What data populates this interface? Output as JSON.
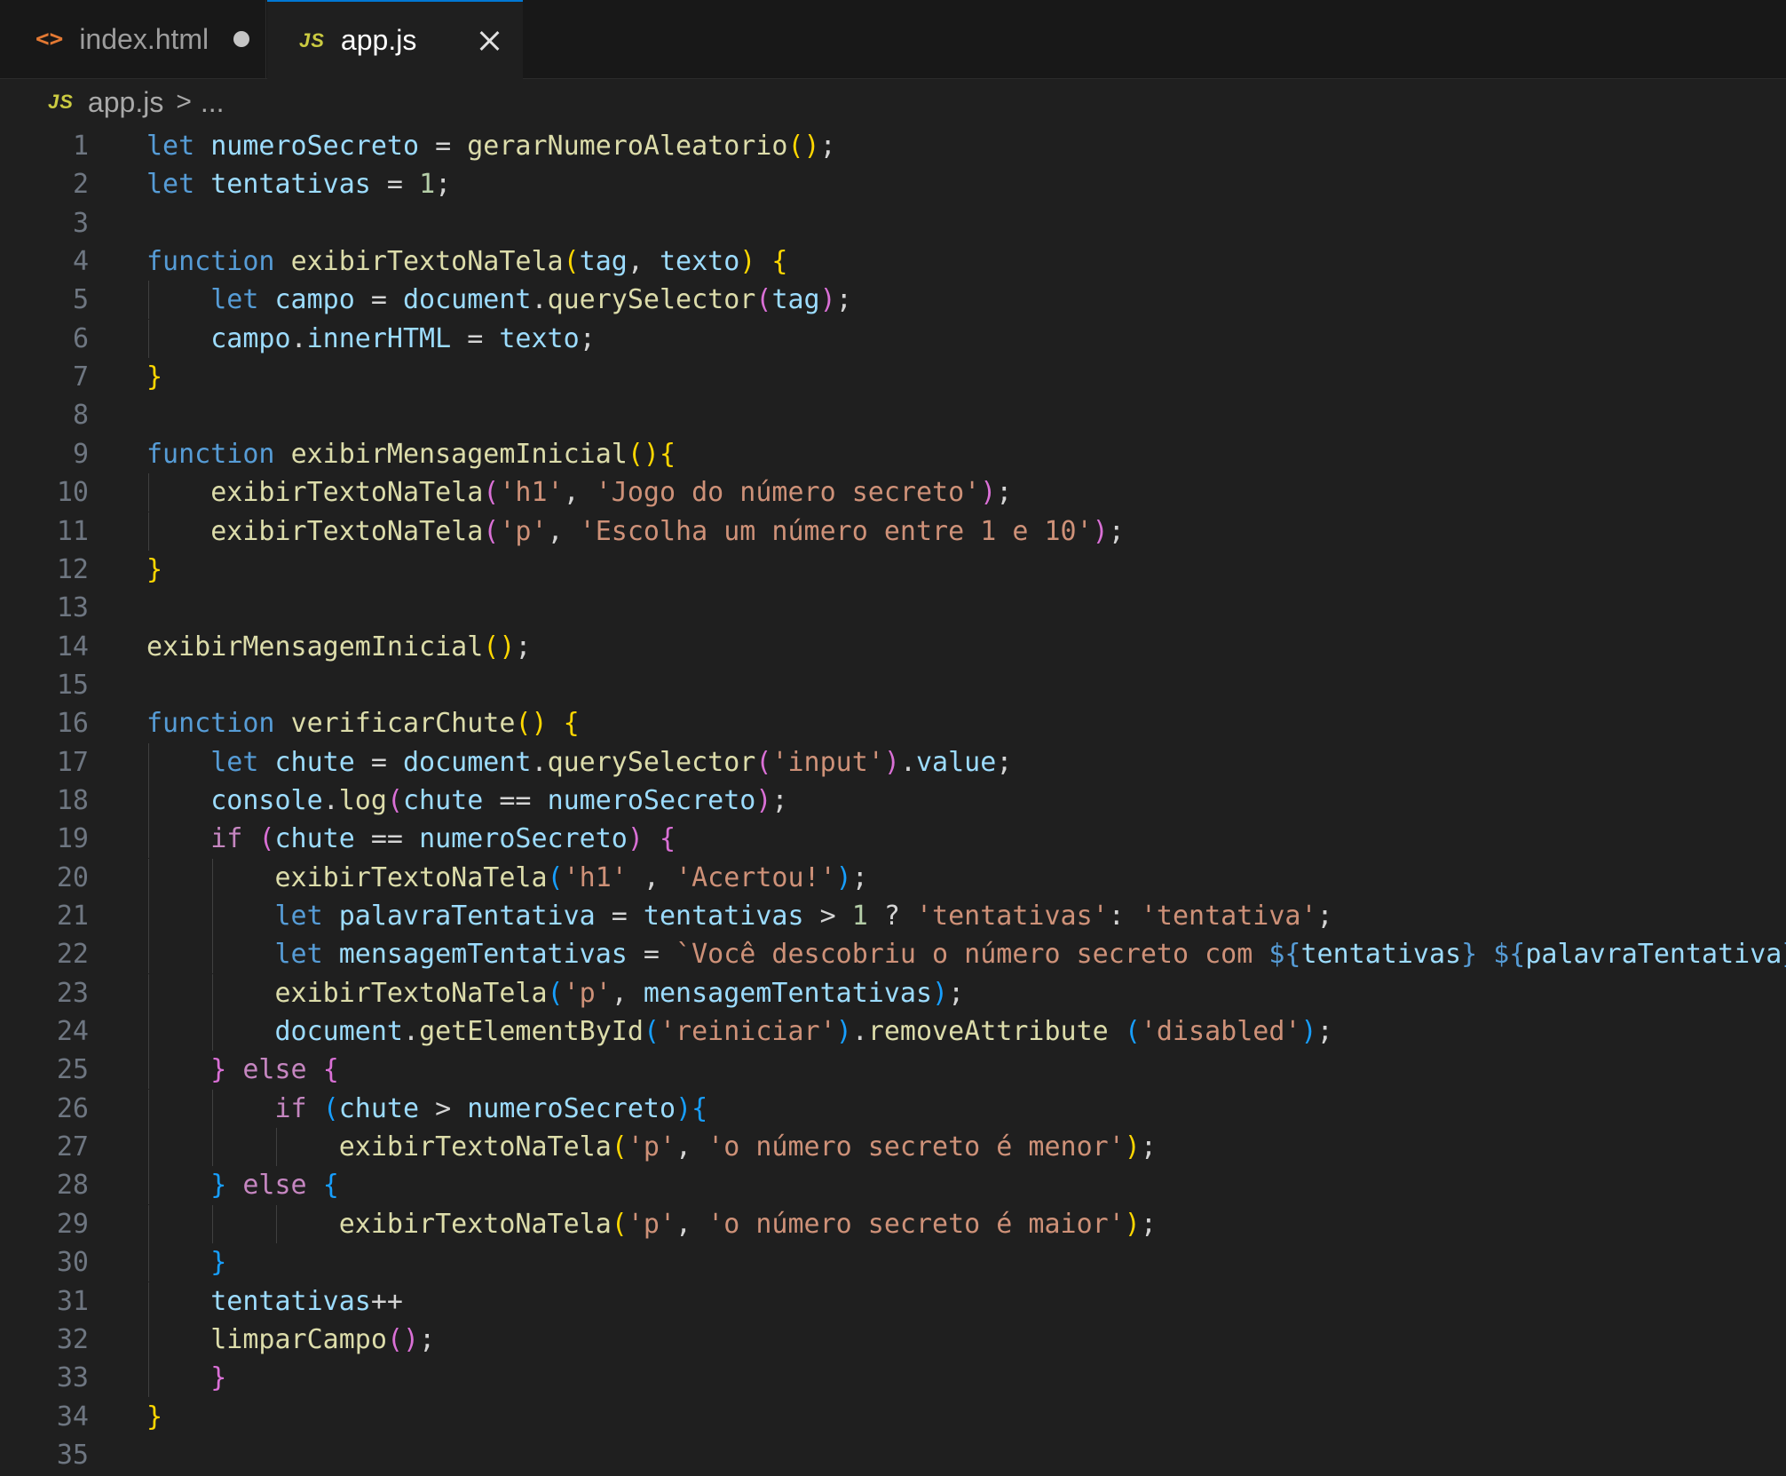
{
  "tabs": [
    {
      "icon": "html-icon",
      "glyph": "<>",
      "label": "index.html",
      "modified": true,
      "active": false
    },
    {
      "icon": "js-icon",
      "glyph": "JS",
      "label": "app.js",
      "modified": false,
      "active": true
    }
  ],
  "breadcrumb": {
    "icon_glyph": "JS",
    "file": "app.js",
    "separator": ">",
    "more": "..."
  },
  "editor": {
    "lines": [
      {
        "n": "1",
        "guides": [],
        "tokens": [
          [
            "k",
            "let"
          ],
          [
            "p",
            " "
          ],
          [
            "v",
            "numeroSecreto"
          ],
          [
            "p",
            " = "
          ],
          [
            "f",
            "gerarNumeroAleatorio"
          ],
          [
            "b1",
            "()"
          ],
          [
            "p",
            ";"
          ]
        ]
      },
      {
        "n": "2",
        "guides": [],
        "tokens": [
          [
            "k",
            "let"
          ],
          [
            "p",
            " "
          ],
          [
            "v",
            "tentativas"
          ],
          [
            "p",
            " = "
          ],
          [
            "n",
            "1"
          ],
          [
            "p",
            ";"
          ]
        ]
      },
      {
        "n": "3",
        "guides": [],
        "tokens": []
      },
      {
        "n": "4",
        "guides": [],
        "tokens": [
          [
            "k",
            "function"
          ],
          [
            "p",
            " "
          ],
          [
            "f",
            "exibirTextoNaTela"
          ],
          [
            "b1",
            "("
          ],
          [
            "v",
            "tag"
          ],
          [
            "p",
            ", "
          ],
          [
            "v",
            "texto"
          ],
          [
            "b1",
            ")"
          ],
          [
            "p",
            " "
          ],
          [
            "b1",
            "{"
          ]
        ]
      },
      {
        "n": "5",
        "guides": [
          1
        ],
        "tokens": [
          [
            "p",
            "    "
          ],
          [
            "k",
            "let"
          ],
          [
            "p",
            " "
          ],
          [
            "v",
            "campo"
          ],
          [
            "p",
            " = "
          ],
          [
            "v",
            "document"
          ],
          [
            "p",
            "."
          ],
          [
            "f",
            "querySelector"
          ],
          [
            "b2",
            "("
          ],
          [
            "v",
            "tag"
          ],
          [
            "b2",
            ")"
          ],
          [
            "p",
            ";"
          ]
        ]
      },
      {
        "n": "6",
        "guides": [
          1
        ],
        "tokens": [
          [
            "p",
            "    "
          ],
          [
            "v",
            "campo"
          ],
          [
            "p",
            "."
          ],
          [
            "v",
            "innerHTML"
          ],
          [
            "p",
            " = "
          ],
          [
            "v",
            "texto"
          ],
          [
            "p",
            ";"
          ]
        ]
      },
      {
        "n": "7",
        "guides": [],
        "tokens": [
          [
            "b1",
            "}"
          ]
        ]
      },
      {
        "n": "8",
        "guides": [],
        "tokens": []
      },
      {
        "n": "9",
        "guides": [],
        "tokens": [
          [
            "k",
            "function"
          ],
          [
            "p",
            " "
          ],
          [
            "f",
            "exibirMensagemInicial"
          ],
          [
            "b1",
            "(){"
          ]
        ]
      },
      {
        "n": "10",
        "guides": [
          1
        ],
        "tokens": [
          [
            "p",
            "    "
          ],
          [
            "f",
            "exibirTextoNaTela"
          ],
          [
            "b2",
            "("
          ],
          [
            "s",
            "'h1'"
          ],
          [
            "p",
            ", "
          ],
          [
            "s",
            "'Jogo do número secreto'"
          ],
          [
            "b2",
            ")"
          ],
          [
            "p",
            ";"
          ]
        ]
      },
      {
        "n": "11",
        "guides": [
          1
        ],
        "tokens": [
          [
            "p",
            "    "
          ],
          [
            "f",
            "exibirTextoNaTela"
          ],
          [
            "b2",
            "("
          ],
          [
            "s",
            "'p'"
          ],
          [
            "p",
            ", "
          ],
          [
            "s",
            "'Escolha um número entre 1 e 10'"
          ],
          [
            "b2",
            ")"
          ],
          [
            "p",
            ";"
          ]
        ]
      },
      {
        "n": "12",
        "guides": [],
        "tokens": [
          [
            "b1",
            "}"
          ]
        ]
      },
      {
        "n": "13",
        "guides": [],
        "tokens": []
      },
      {
        "n": "14",
        "guides": [],
        "tokens": [
          [
            "f",
            "exibirMensagemInicial"
          ],
          [
            "b1",
            "()"
          ],
          [
            "p",
            ";"
          ]
        ]
      },
      {
        "n": "15",
        "guides": [],
        "tokens": []
      },
      {
        "n": "16",
        "guides": [],
        "tokens": [
          [
            "k",
            "function"
          ],
          [
            "p",
            " "
          ],
          [
            "f",
            "verificarChute"
          ],
          [
            "b1",
            "()"
          ],
          [
            "p",
            " "
          ],
          [
            "b1",
            "{"
          ]
        ]
      },
      {
        "n": "17",
        "guides": [
          1
        ],
        "tokens": [
          [
            "p",
            "    "
          ],
          [
            "k",
            "let"
          ],
          [
            "p",
            " "
          ],
          [
            "v",
            "chute"
          ],
          [
            "p",
            " = "
          ],
          [
            "v",
            "document"
          ],
          [
            "p",
            "."
          ],
          [
            "f",
            "querySelector"
          ],
          [
            "b2",
            "("
          ],
          [
            "s",
            "'input'"
          ],
          [
            "b2",
            ")"
          ],
          [
            "p",
            "."
          ],
          [
            "v",
            "value"
          ],
          [
            "p",
            ";"
          ]
        ]
      },
      {
        "n": "18",
        "guides": [
          1
        ],
        "tokens": [
          [
            "p",
            "    "
          ],
          [
            "v",
            "console"
          ],
          [
            "p",
            "."
          ],
          [
            "f",
            "log"
          ],
          [
            "b2",
            "("
          ],
          [
            "v",
            "chute"
          ],
          [
            "p",
            " == "
          ],
          [
            "v",
            "numeroSecreto"
          ],
          [
            "b2",
            ")"
          ],
          [
            "p",
            ";"
          ]
        ]
      },
      {
        "n": "19",
        "guides": [
          1
        ],
        "tokens": [
          [
            "p",
            "    "
          ],
          [
            "c",
            "if"
          ],
          [
            "p",
            " "
          ],
          [
            "b2",
            "("
          ],
          [
            "v",
            "chute"
          ],
          [
            "p",
            " == "
          ],
          [
            "v",
            "numeroSecreto"
          ],
          [
            "b2",
            ")"
          ],
          [
            "p",
            " "
          ],
          [
            "b2",
            "{"
          ]
        ]
      },
      {
        "n": "20",
        "guides": [
          1,
          2
        ],
        "tokens": [
          [
            "p",
            "        "
          ],
          [
            "f",
            "exibirTextoNaTela"
          ],
          [
            "b3",
            "("
          ],
          [
            "s",
            "'h1'"
          ],
          [
            "p",
            " , "
          ],
          [
            "s",
            "'Acertou!'"
          ],
          [
            "b3",
            ")"
          ],
          [
            "p",
            ";"
          ]
        ]
      },
      {
        "n": "21",
        "guides": [
          1,
          2
        ],
        "tokens": [
          [
            "p",
            "        "
          ],
          [
            "k",
            "let"
          ],
          [
            "p",
            " "
          ],
          [
            "v",
            "palavraTentativa"
          ],
          [
            "p",
            " = "
          ],
          [
            "v",
            "tentativas"
          ],
          [
            "p",
            " > "
          ],
          [
            "n",
            "1"
          ],
          [
            "p",
            " ? "
          ],
          [
            "s",
            "'tentativas'"
          ],
          [
            "p",
            ": "
          ],
          [
            "s",
            "'tentativa'"
          ],
          [
            "p",
            ";"
          ]
        ]
      },
      {
        "n": "22",
        "guides": [
          1,
          2
        ],
        "tokens": [
          [
            "p",
            "        "
          ],
          [
            "k",
            "let"
          ],
          [
            "p",
            " "
          ],
          [
            "v",
            "mensagemTentativas"
          ],
          [
            "p",
            " = "
          ],
          [
            "s",
            "`Você descobriu o número secreto com "
          ],
          [
            "k",
            "${"
          ],
          [
            "v",
            "tentativas"
          ],
          [
            "k",
            "}"
          ],
          [
            "p",
            " "
          ],
          [
            "k",
            "${"
          ],
          [
            "v",
            "palavraTentativa"
          ],
          [
            "k",
            "}"
          ],
          [
            "s",
            "!`"
          ],
          [
            "p",
            ";"
          ]
        ]
      },
      {
        "n": "23",
        "guides": [
          1,
          2
        ],
        "tokens": [
          [
            "p",
            "        "
          ],
          [
            "f",
            "exibirTextoNaTela"
          ],
          [
            "b3",
            "("
          ],
          [
            "s",
            "'p'"
          ],
          [
            "p",
            ", "
          ],
          [
            "v",
            "mensagemTentativas"
          ],
          [
            "b3",
            ")"
          ],
          [
            "p",
            ";"
          ]
        ]
      },
      {
        "n": "24",
        "guides": [
          1,
          2
        ],
        "tokens": [
          [
            "p",
            "        "
          ],
          [
            "v",
            "document"
          ],
          [
            "p",
            "."
          ],
          [
            "f",
            "getElementById"
          ],
          [
            "b3",
            "("
          ],
          [
            "s",
            "'reiniciar'"
          ],
          [
            "b3",
            ")"
          ],
          [
            "p",
            "."
          ],
          [
            "f",
            "removeAttribute"
          ],
          [
            "p",
            " "
          ],
          [
            "b3",
            "("
          ],
          [
            "s",
            "'disabled'"
          ],
          [
            "b3",
            ")"
          ],
          [
            "p",
            ";"
          ]
        ]
      },
      {
        "n": "25",
        "guides": [
          1
        ],
        "tokens": [
          [
            "p",
            "    "
          ],
          [
            "b2",
            "}"
          ],
          [
            "p",
            " "
          ],
          [
            "c",
            "else"
          ],
          [
            "p",
            " "
          ],
          [
            "b2",
            "{"
          ]
        ]
      },
      {
        "n": "26",
        "guides": [
          1,
          2
        ],
        "tokens": [
          [
            "p",
            "        "
          ],
          [
            "c",
            "if"
          ],
          [
            "p",
            " "
          ],
          [
            "b3",
            "("
          ],
          [
            "v",
            "chute"
          ],
          [
            "p",
            " > "
          ],
          [
            "v",
            "numeroSecreto"
          ],
          [
            "b3",
            ")"
          ],
          [
            "b3",
            "{"
          ]
        ]
      },
      {
        "n": "27",
        "guides": [
          1,
          2,
          3
        ],
        "tokens": [
          [
            "p",
            "            "
          ],
          [
            "f",
            "exibirTextoNaTela"
          ],
          [
            "b1",
            "("
          ],
          [
            "s",
            "'p'"
          ],
          [
            "p",
            ", "
          ],
          [
            "s",
            "'o número secreto é menor'"
          ],
          [
            "b1",
            ")"
          ],
          [
            "p",
            ";"
          ]
        ]
      },
      {
        "n": "28",
        "guides": [
          1
        ],
        "tokens": [
          [
            "p",
            "    "
          ],
          [
            "b3",
            "}"
          ],
          [
            "p",
            " "
          ],
          [
            "c",
            "else"
          ],
          [
            "p",
            " "
          ],
          [
            "b3",
            "{"
          ]
        ]
      },
      {
        "n": "29",
        "guides": [
          1,
          2,
          3
        ],
        "tokens": [
          [
            "p",
            "            "
          ],
          [
            "f",
            "exibirTextoNaTela"
          ],
          [
            "b1",
            "("
          ],
          [
            "s",
            "'p'"
          ],
          [
            "p",
            ", "
          ],
          [
            "s",
            "'o número secreto é maior'"
          ],
          [
            "b1",
            ")"
          ],
          [
            "p",
            ";"
          ]
        ]
      },
      {
        "n": "30",
        "guides": [
          1
        ],
        "tokens": [
          [
            "p",
            "    "
          ],
          [
            "b3",
            "}"
          ]
        ]
      },
      {
        "n": "31",
        "guides": [
          1
        ],
        "tokens": [
          [
            "p",
            "    "
          ],
          [
            "v",
            "tentativas"
          ],
          [
            "p",
            "++"
          ]
        ]
      },
      {
        "n": "32",
        "guides": [
          1
        ],
        "tokens": [
          [
            "p",
            "    "
          ],
          [
            "f",
            "limparCampo"
          ],
          [
            "b2",
            "("
          ],
          [
            "b2",
            ")"
          ],
          [
            "p",
            ";"
          ]
        ]
      },
      {
        "n": "33",
        "guides": [
          1
        ],
        "tokens": [
          [
            "p",
            "    "
          ],
          [
            "b2",
            "}"
          ]
        ]
      },
      {
        "n": "34",
        "guides": [],
        "tokens": [
          [
            "b1",
            "}"
          ]
        ]
      },
      {
        "n": "35",
        "guides": [],
        "tokens": []
      }
    ]
  },
  "colors": {
    "background": "#1f1f1f",
    "tabbar": "#181818",
    "active_tab_border": "#0078d4",
    "keyword": "#569cd6",
    "control": "#c586c0",
    "function": "#dcdcaa",
    "variable": "#9cdcfe",
    "string": "#ce9178",
    "number": "#b5cea8"
  }
}
